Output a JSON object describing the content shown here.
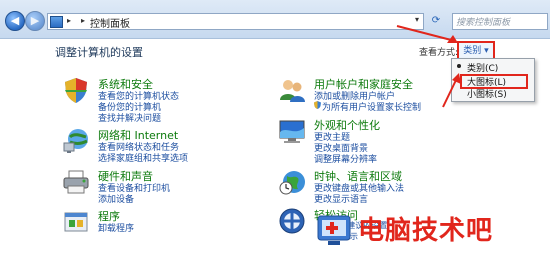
{
  "address": {
    "crumb": "控制面板",
    "search_placeholder": "搜索控制面板"
  },
  "header": {
    "title": "调整计算机的设置",
    "view_label": "查看方式:",
    "view_value": "类别 ▾"
  },
  "view_menu": {
    "items": [
      "类别(C)",
      "大图标(L)",
      "小图标(S)"
    ]
  },
  "categories": [
    {
      "title": "系统和安全",
      "links": [
        "查看您的计算机状态",
        "备份您的计算机",
        "查找并解决问题"
      ],
      "icon": "shield-icon"
    },
    {
      "title": "网络和 Internet",
      "links": [
        "查看网络状态和任务",
        "选择家庭组和共享选项"
      ],
      "icon": "network-icon"
    },
    {
      "title": "硬件和声音",
      "links": [
        "查看设备和打印机",
        "添加设备"
      ],
      "icon": "printer-icon"
    },
    {
      "title": "程序",
      "links": [
        "卸载程序"
      ],
      "icon": "programs-icon"
    },
    {
      "title": "用户帐户和家庭安全",
      "links": [
        "添加或删除用户帐户",
        "为所有用户设置家长控制"
      ],
      "icon": "users-icon"
    },
    {
      "title": "外观和个性化",
      "links": [
        "更改主题",
        "更改桌面背景",
        "调整屏幕分辨率"
      ],
      "icon": "appearance-icon"
    },
    {
      "title": "时钟、语言和区域",
      "links": [
        "更改键盘或其他输入法",
        "更改显示语言"
      ],
      "icon": "globe-clock-icon"
    },
    {
      "title": "轻松访问",
      "links": [
        "ws 建议的设置",
        "觉显示"
      ],
      "icon": "ease-of-access-icon"
    }
  ],
  "watermark": {
    "text": "电脑技术吧"
  },
  "colors": {
    "accent_red": "#e1261c",
    "link_blue": "#1e4fa0",
    "category_green": "#0c7a0c"
  }
}
